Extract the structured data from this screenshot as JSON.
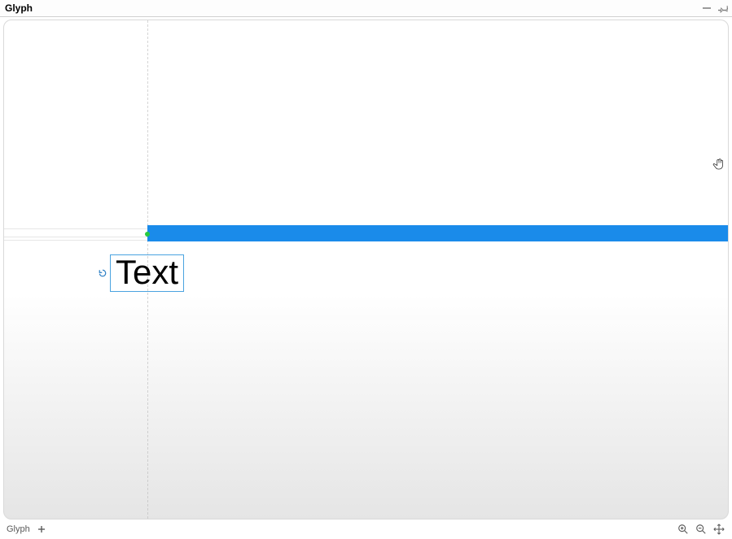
{
  "panel": {
    "title": "Glyph"
  },
  "canvas": {
    "text_element": {
      "value": "Text"
    }
  },
  "statusbar": {
    "tab_label": "Glyph"
  },
  "colors": {
    "highlight": "#1a8bea",
    "selection_border": "#4aa3e0"
  }
}
